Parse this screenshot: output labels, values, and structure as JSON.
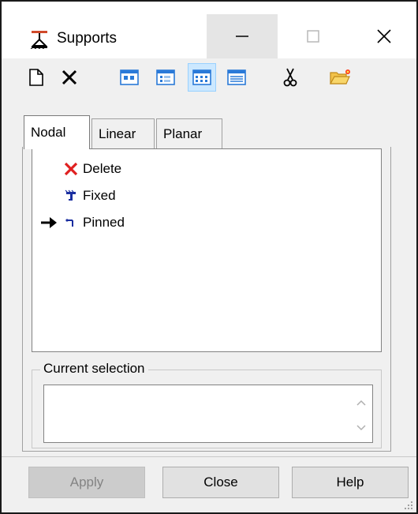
{
  "window": {
    "title": "Supports",
    "controls": [
      "minimize",
      "maximize",
      "close"
    ]
  },
  "toolbar": {
    "items": [
      {
        "name": "new",
        "icon": "new-document-icon"
      },
      {
        "name": "delete",
        "icon": "delete-x-icon"
      },
      {
        "name": "view-large-icons",
        "icon": "large-icons-view-icon"
      },
      {
        "name": "view-small-icons",
        "icon": "small-icons-view-icon"
      },
      {
        "name": "view-list",
        "icon": "list-view-icon",
        "pressed": true
      },
      {
        "name": "view-details",
        "icon": "details-view-icon"
      },
      {
        "name": "cut",
        "icon": "scissors-icon"
      },
      {
        "name": "open",
        "icon": "open-folder-icon"
      }
    ]
  },
  "tabs": [
    {
      "label": "Nodal",
      "active": true
    },
    {
      "label": "Linear",
      "active": false
    },
    {
      "label": "Planar",
      "active": false
    }
  ],
  "list": {
    "items": [
      {
        "label": "Delete",
        "icon": "red-x-icon",
        "current": false
      },
      {
        "label": "Fixed",
        "icon": "fixed-support-icon",
        "current": false
      },
      {
        "label": "Pinned",
        "icon": "pinned-support-icon",
        "current": true
      }
    ]
  },
  "current_selection": {
    "label": "Current selection",
    "value": ""
  },
  "buttons": {
    "apply": "Apply",
    "close": "Close",
    "help": "Help"
  },
  "colors": {
    "accent_pressed": "#cce8ff",
    "delete_red": "#e02020",
    "support_blue": "#1a2ea0"
  }
}
